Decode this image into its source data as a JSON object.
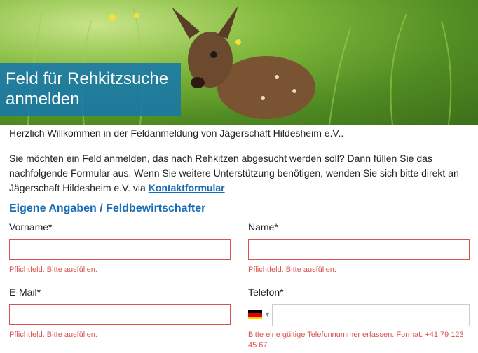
{
  "hero": {
    "title": "Feld für Rehkitzsuche anmelden"
  },
  "intro": "Herzlich Willkommen in der Feldanmeldung von Jägerschaft Hildesheim e.V..",
  "paragraph": {
    "text": "Sie möchten ein Feld anmelden, das nach Rehkitzen abgesucht werden soll? Dann füllen Sie das nachfolgende Formular aus. Wenn Sie weitere Unterstützung benötigen, wenden Sie sich bitte direkt an Jägerschaft Hildesheim e.V. via",
    "link": "Kontaktformular"
  },
  "section_title": "Eigene Angaben / Feldbewirtschafter",
  "form": {
    "vorname": {
      "label": "Vorname*",
      "value": "",
      "error": "Pflichtfeld. Bitte ausfüllen."
    },
    "name": {
      "label": "Name*",
      "value": "",
      "error": "Pflichtfeld. Bitte ausfüllen."
    },
    "email": {
      "label": "E-Mail*",
      "value": "",
      "error": "Pflichtfeld. Bitte ausfüllen."
    },
    "telefon": {
      "label": "Telefon*",
      "value": "",
      "country": "de-flag-icon",
      "error": "Bitte eine gültige Telefonnummer erfassen. Format: +41 79 123 45 67"
    }
  },
  "colors": {
    "accent": "#1a6db5",
    "error": "#d9534f",
    "hero_overlay": "#1776aa"
  }
}
